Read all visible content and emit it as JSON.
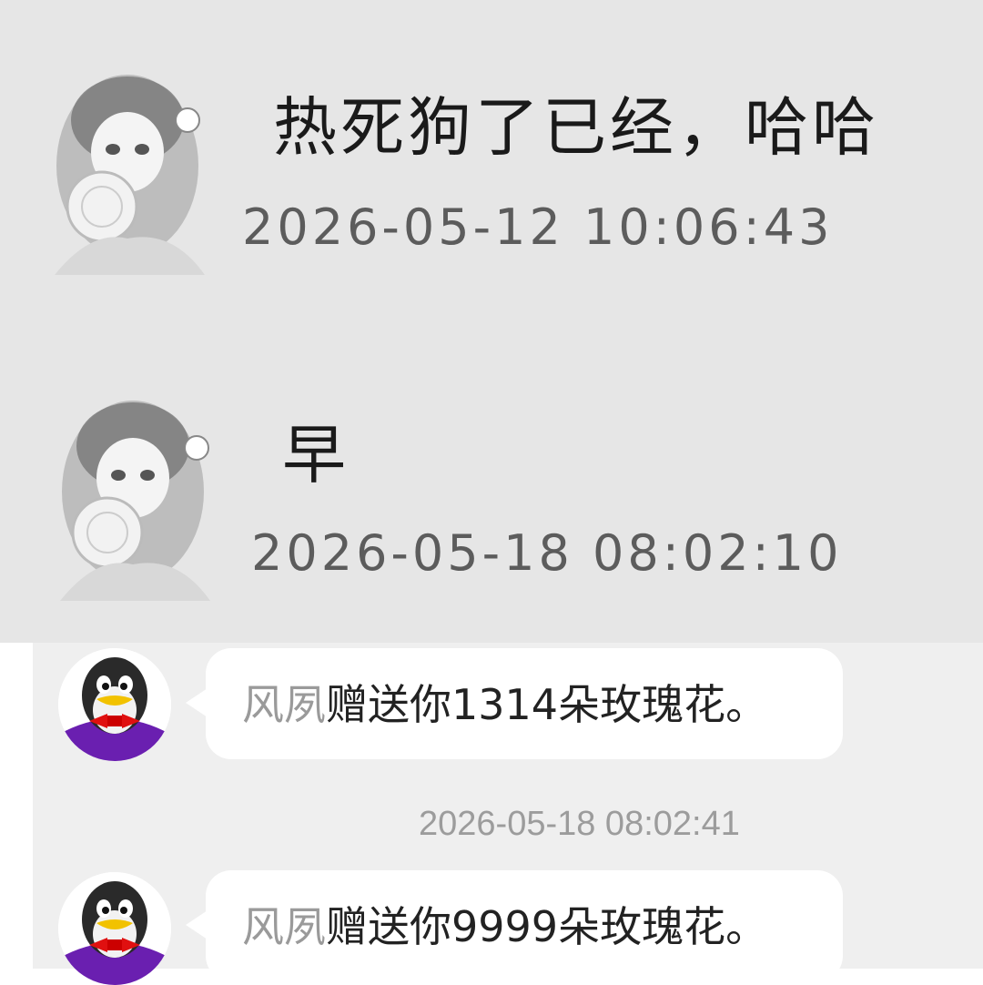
{
  "top_messages": [
    {
      "text": "热死狗了已经，哈哈",
      "time": "2026-05-12 10:06:43"
    },
    {
      "text": "早",
      "time": "2026-05-18 08:02:10"
    }
  ],
  "gift_messages": [
    {
      "sender": "风夙",
      "text": "赠送你1314朵玫瑰花。"
    },
    {
      "sender": "风夙",
      "text": "赠送你9999朵玫瑰花。"
    }
  ],
  "system_time": "2026-05-18 08:02:41",
  "icons": {
    "top_avatar": "anime-girl-avatar",
    "bottom_avatar": "qq-penguin-avatar"
  }
}
